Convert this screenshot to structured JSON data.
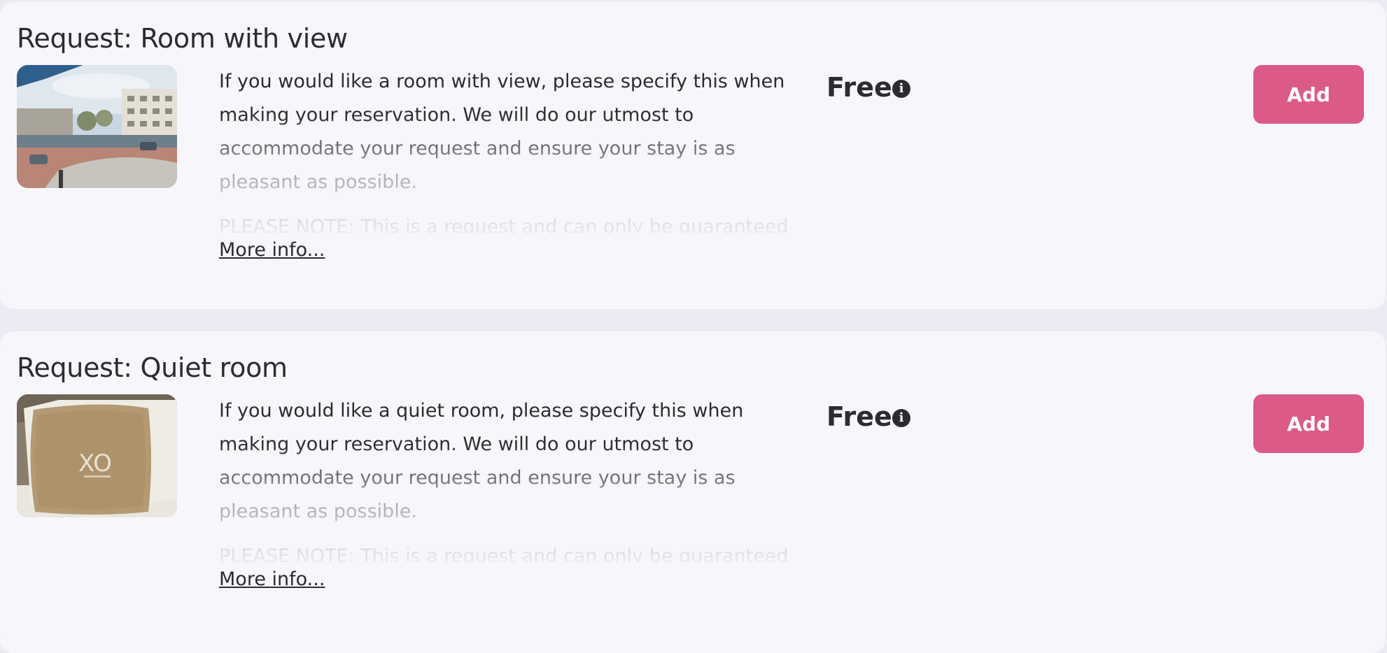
{
  "requests": [
    {
      "title": "Request: Room with view",
      "image_alt": "Room with view photo",
      "description": "If you would like a room with view, please specify this when making your reservation. We will do our utmost to accommodate your request and ensure your stay is as pleasant as possible.",
      "note": "PLEASE NOTE: This is a request and can only be guaranteed",
      "more_info": "More info...",
      "price": "Free",
      "info_icon": "info-circle-icon",
      "add_label": "Add"
    },
    {
      "title": "Request: Quiet room",
      "image_alt": "Quiet room pillow photo",
      "description": "If you would like a quiet room, please specify this when making your reservation. We will do our utmost to accommodate your request and ensure your stay is as pleasant as possible.",
      "note": "PLEASE NOTE: This is a request and can only be guaranteed",
      "more_info": "More info...",
      "price": "Free",
      "info_icon": "info-circle-icon",
      "pillow_print": "XO",
      "add_label": "Add"
    }
  ],
  "colors": {
    "page_background": "#ebebf3",
    "card_background": "#f7f7fb",
    "text": "#2b2b30",
    "add_button": "#db5a88"
  }
}
